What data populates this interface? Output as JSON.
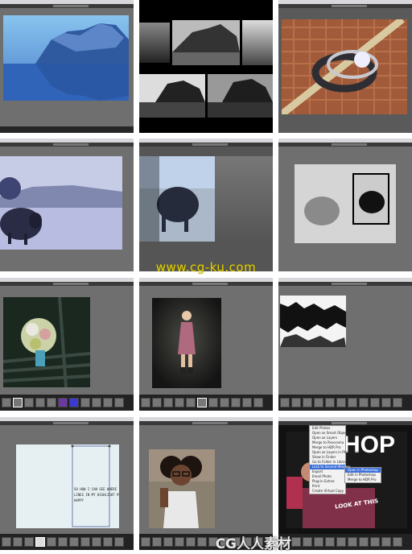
{
  "watermark": {
    "url": "www.cg-ku.com",
    "logo_text": "CG人人素材"
  },
  "cells": [
    {
      "id": "1",
      "content": "blue landscape rock reflection"
    },
    {
      "id": "2",
      "content": "black and white rock comparison"
    },
    {
      "id": "3",
      "content": "wedding rings on burlap"
    },
    {
      "id": "4",
      "content": "bison blue tone"
    },
    {
      "id": "5",
      "content": "bison survey view"
    },
    {
      "id": "6",
      "content": "bison black and white"
    },
    {
      "id": "7",
      "content": "bouquet on chair"
    },
    {
      "id": "8",
      "content": "girl in dress"
    },
    {
      "id": "9",
      "content": "texture overlay"
    },
    {
      "id": "10",
      "content": "handwritten note"
    },
    {
      "id": "11",
      "content": "girl with glasses"
    },
    {
      "id": "12",
      "content": "magazine cover with menu"
    }
  ],
  "note_text": "SO HOW I CAN SEE WHERE\nLINES IN MY HIGHLIGHT PLATE\nHAPPY",
  "magazine": {
    "masthead": "HOP",
    "sidetext": "LOOK AT THIS"
  },
  "menu_items": [
    "Edit Photos",
    "Open as Smart Object",
    "Open as Layers",
    "",
    "Merge to Panorama",
    "Merge to HDR Pro",
    "Open as Layers in Photoshop",
    "",
    "Show in Finder",
    "Go to Folder in Library",
    "Lock to Second Window",
    "",
    "Export",
    "Email Photo",
    "Plug-in Extras",
    "",
    "Print",
    "Create Virtual Copy"
  ],
  "submenu_items": [
    "Open in Photoshop",
    "Edit in Photoshop",
    "Merge to HDR Pro"
  ]
}
